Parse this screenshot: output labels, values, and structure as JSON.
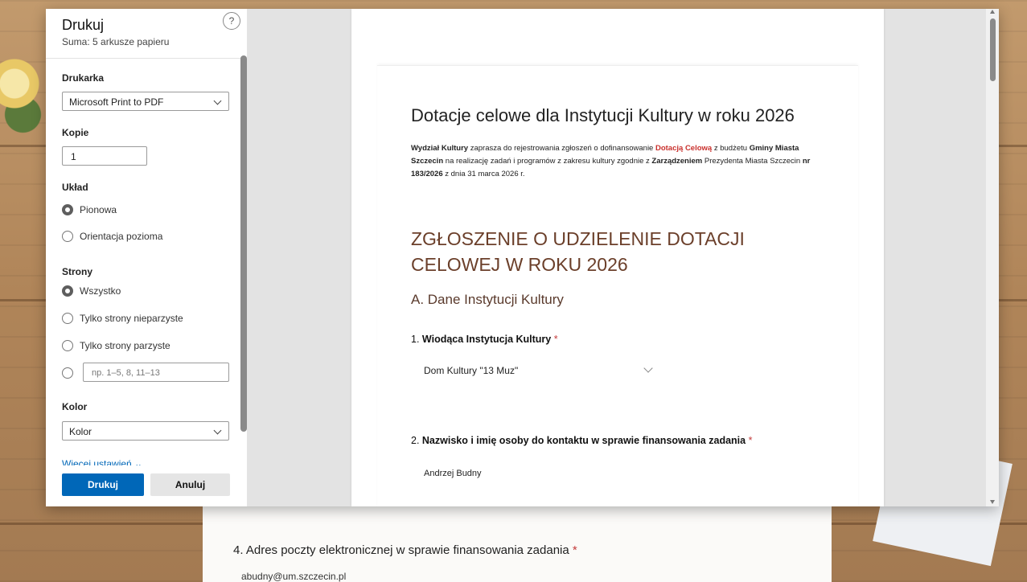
{
  "dialog": {
    "title": "Drukuj",
    "subtitle": "Suma: 5 arkusze papieru",
    "help_label": "?"
  },
  "printer": {
    "label": "Drukarka",
    "value": "Microsoft Print to PDF"
  },
  "copies": {
    "label": "Kopie",
    "value": "1"
  },
  "layout": {
    "label": "Układ",
    "options": [
      "Pionowa",
      "Orientacja pozioma"
    ],
    "selected": "Pionowa"
  },
  "pages": {
    "label": "Strony",
    "options": [
      "Wszystko",
      "Tylko strony nieparzyste",
      "Tylko strony parzyste"
    ],
    "custom_placeholder": "np. 1–5, 8, 11–13",
    "selected": "Wszystko"
  },
  "color": {
    "label": "Kolor",
    "value": "Kolor"
  },
  "more_settings": "Więcej ustawień  ⌄",
  "buttons": {
    "print": "Drukuj",
    "cancel": "Anuluj"
  },
  "preview": {
    "doc_title": "Dotacje celowe dla Instytucji Kultury w roku 2026",
    "intro": {
      "p1_bold": "Wydział Kultury",
      "p2": " zaprasza do rejestrowania zgłoszeń o dofinansowanie ",
      "p3_red": "Dotacją Celową",
      "p4": " z budżetu ",
      "p5_bold": "Gminy Miasta Szczecin",
      "p6": " na realizację zadań i programów z zakresu kultury zgodnie z ",
      "p7_bold": "Zarządzeniem",
      "p8": " Prezydenta Miasta Szczecin ",
      "p9_bold": "nr 183/2026",
      "p10": " z dnia 31 marca 2026 r."
    },
    "section_title": "ZGŁOSZENIE O UDZIELENIE DOTACJI CELOWEJ W ROKU 2026",
    "section_sub": "A. Dane Instytucji Kultury",
    "q1": {
      "num": "1. ",
      "label": "Wiodąca Instytucja Kultury",
      "star": " *",
      "answer": "Dom Kultury \"13 Muz\""
    },
    "q2": {
      "num": "2. ",
      "label": "Nazwisko i imię osoby do kontaktu w sprawie finansowania zadania",
      "star": " *",
      "answer": "Andrzej Budny"
    }
  },
  "background": {
    "q4_label": "4. Adres poczty elektronicznej w sprawie finansowania zadania",
    "q4_star": " *",
    "q4_answer": "abudny@um.szczecin.pl"
  }
}
